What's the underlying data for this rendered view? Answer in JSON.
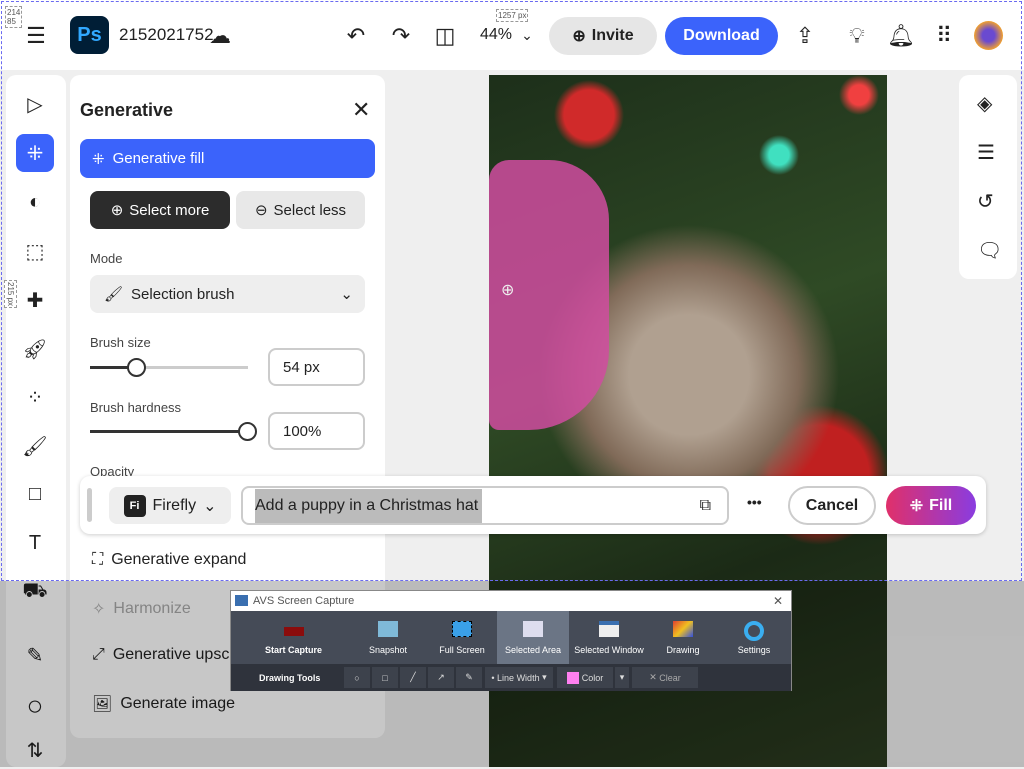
{
  "header": {
    "doc_name": "2152021752",
    "zoom": "44%",
    "invite": "Invite",
    "download": "Download",
    "app_logo": "Ps"
  },
  "panel": {
    "title": "Generative",
    "generative_fill": "Generative fill",
    "select_more": "Select more",
    "select_less": "Select less",
    "mode_label": "Mode",
    "mode_value": "Selection brush",
    "brush_size_label": "Brush size",
    "brush_size": "54 px",
    "brush_size_fraction": 0.3,
    "brush_hardness_label": "Brush hardness",
    "brush_hardness": "100%",
    "brush_hardness_fraction": 1.0,
    "opacity_label": "Opacity",
    "items": [
      "Generative expand",
      "Harmonize",
      "Generative upscale",
      "Generate image"
    ]
  },
  "prompt_bar": {
    "model": "Firefly",
    "model_badge": "Fi",
    "prompt": "Add a puppy in a Christmas hat",
    "more": "•••",
    "cancel": "Cancel",
    "fill": "Fill"
  },
  "overlay": {
    "measure_tl": "214\n85",
    "measure_w": "1257 px",
    "measure_h": "215 px"
  },
  "avs": {
    "title": "AVS Screen Capture",
    "buttons": [
      "Start Capture",
      "Snapshot",
      "Full Screen",
      "Selected Area",
      "Selected Window",
      "Drawing",
      "Settings"
    ],
    "drawing_tools": "Drawing Tools",
    "line_width": "Line Width",
    "color": "Color",
    "clear": "Clear",
    "color_value": "#ff80f0"
  }
}
